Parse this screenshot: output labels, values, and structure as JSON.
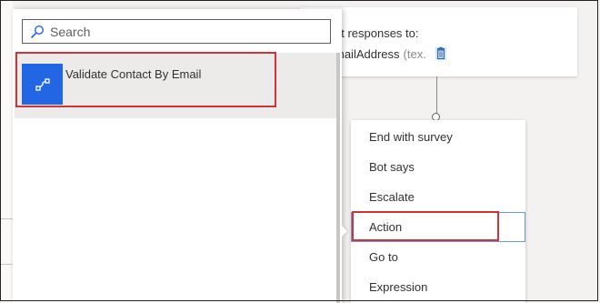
{
  "responses_card": {
    "title_fragment": "ut responses to:",
    "variable_fragment": "mailAddress",
    "type_fragment": "(tex."
  },
  "search": {
    "placeholder": "Search",
    "value": ""
  },
  "results": [
    {
      "label": "Validate Contact By Email",
      "icon": "flow-icon",
      "selected": true
    }
  ],
  "menu": {
    "items": [
      {
        "label": "End with survey"
      },
      {
        "label": "Bot says"
      },
      {
        "label": "Escalate"
      },
      {
        "label": "Action",
        "highlighted": true
      },
      {
        "label": "Go to"
      },
      {
        "label": "Expression"
      }
    ]
  },
  "colors": {
    "accent_blue": "#2266e3",
    "highlight_red": "#d13438",
    "selected_bg": "#edebe9"
  }
}
